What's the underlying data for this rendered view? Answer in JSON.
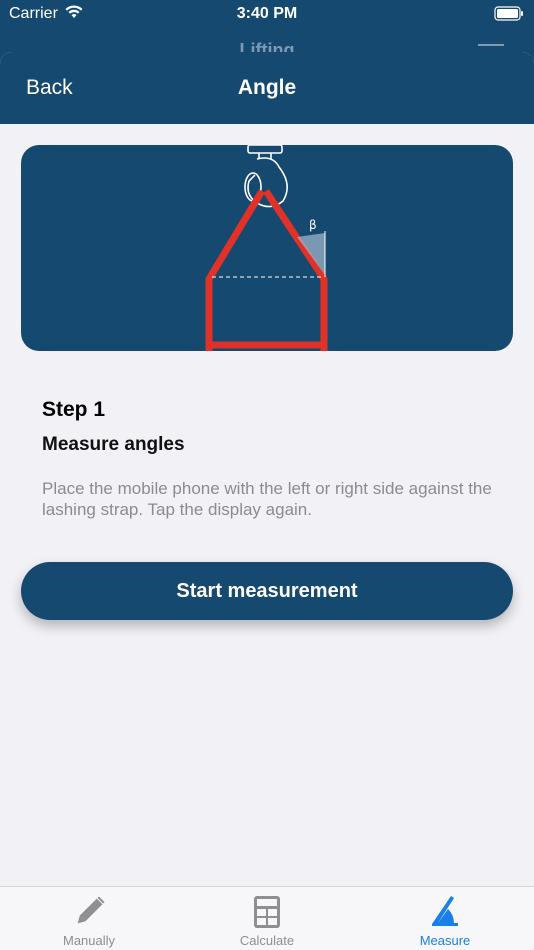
{
  "status_bar": {
    "carrier": "Carrier",
    "time": "3:40 PM"
  },
  "background_screen": {
    "title": "Lifting"
  },
  "navbar": {
    "back_label": "Back",
    "title": "Angle"
  },
  "illustration": {
    "angle_symbol": "β"
  },
  "step": {
    "title": "Step 1",
    "subtitle": "Measure angles",
    "description": "Place the mobile phone with the left or right side against the lashing strap. Tap the display again."
  },
  "start_button": {
    "label": "Start measurement"
  },
  "tabbar": {
    "tabs": [
      {
        "label": "Manually",
        "icon": "pencil-icon",
        "active": false
      },
      {
        "label": "Calculate",
        "icon": "calculator-icon",
        "active": false
      },
      {
        "label": "Measure",
        "icon": "angle-measure-icon",
        "active": true
      }
    ]
  },
  "colors": {
    "primary": "#16496f",
    "accent": "#1a7fe8",
    "strap_red": "#e03228",
    "sheet_bg": "#f1f1f6"
  }
}
